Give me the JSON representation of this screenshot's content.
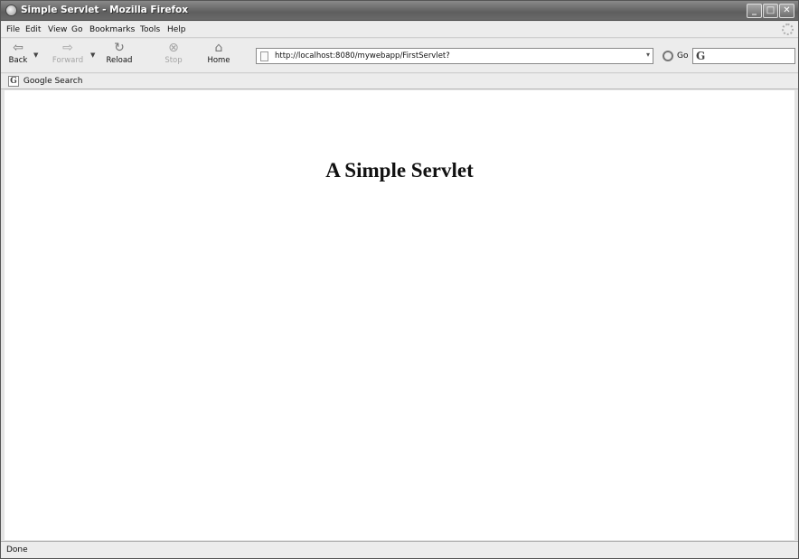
{
  "window": {
    "title": "Simple Servlet - Mozilla Firefox"
  },
  "menu": [
    "File",
    "Edit",
    "View",
    "Go",
    "Bookmarks",
    "Tools",
    "Help"
  ],
  "toolbar": {
    "back": "Back",
    "forward": "Forward",
    "reload": "Reload",
    "stop": "Stop",
    "home": "Home",
    "url": "http://localhost:8080/mywebapp/FirstServlet?",
    "go": "Go",
    "search_glyph": "G"
  },
  "bookmarks": {
    "items": [
      {
        "label": "Google Search",
        "icon": "google-icon"
      }
    ]
  },
  "page": {
    "heading": "A Simple Servlet"
  },
  "status": {
    "text": "Done"
  }
}
